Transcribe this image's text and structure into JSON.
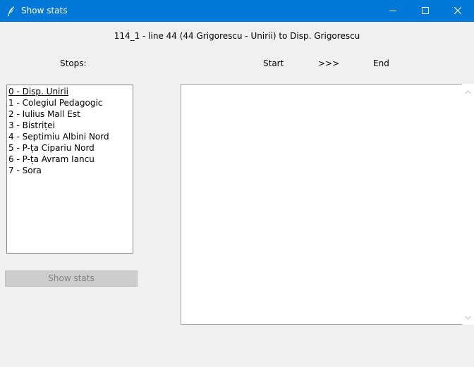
{
  "window": {
    "title": "Show stats",
    "icon": "feather-icon"
  },
  "header": {
    "route": "114_1 - line 44 (44 Grigorescu - Unirii) to Disp. Grigorescu",
    "stops_label": "Stops:",
    "start_label": "Start",
    "arrows_label": ">>>",
    "end_label": "End"
  },
  "stops": {
    "items": [
      "0 - Disp. Unirii",
      "1 - Colegiul Pedagogic",
      "2 - Iulius Mall Est",
      "3 - Bistriței",
      "4 - Septimiu Albini Nord",
      "5 - P-ța Cipariu Nord",
      "6 - P-ța Avram Iancu",
      "7 - Sora"
    ],
    "active_index": 0
  },
  "actions": {
    "show_stats_label": "Show stats"
  },
  "colors": {
    "titlebar": "#0078d7",
    "background": "#f0f0f0",
    "disabled_button": "#cccccc"
  }
}
